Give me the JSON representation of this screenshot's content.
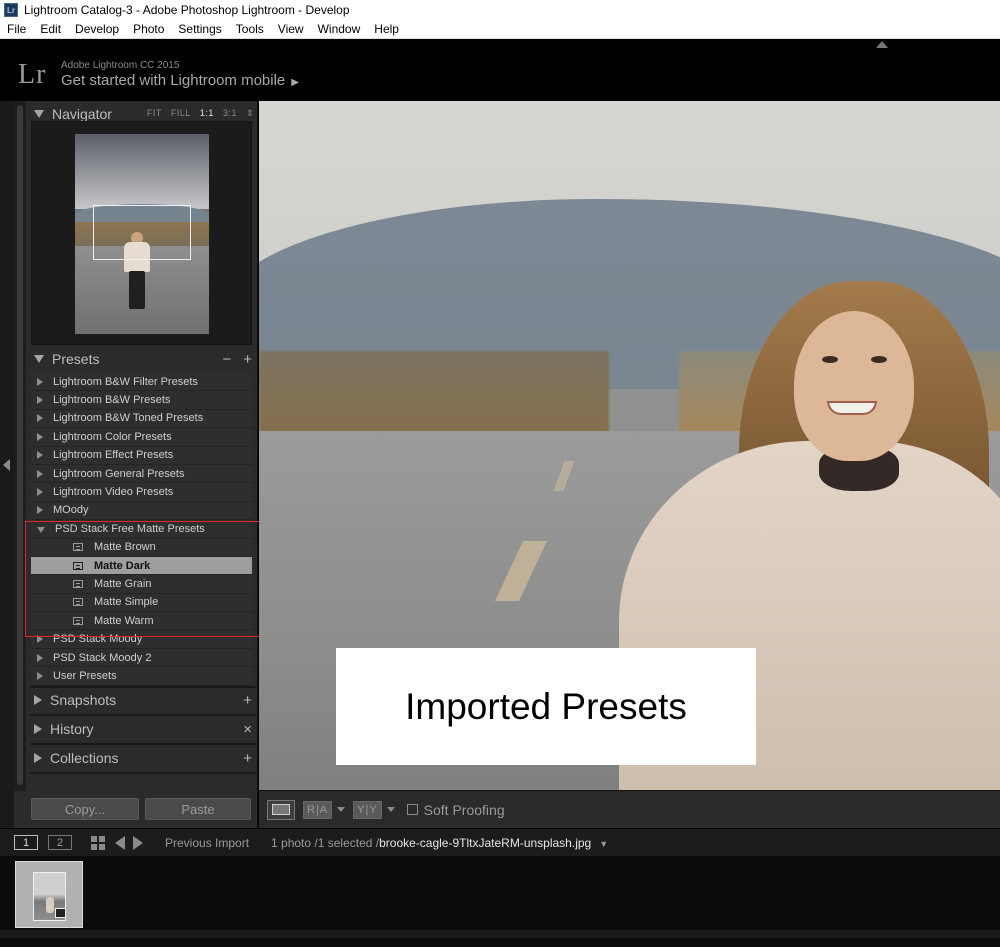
{
  "window": {
    "title": "Lightroom Catalog-3 - Adobe Photoshop Lightroom - Develop",
    "app_icon_text": "Lr"
  },
  "menu": [
    "File",
    "Edit",
    "Develop",
    "Photo",
    "Settings",
    "Tools",
    "View",
    "Window",
    "Help"
  ],
  "identity": {
    "logo": "Lr",
    "product": "Adobe Lightroom CC 2015",
    "mobile_prompt": "Get started with Lightroom mobile",
    "mobile_arrow": "▶"
  },
  "navigator": {
    "title": "Navigator",
    "zoom_options": [
      "FIT",
      "FILL",
      "1:1",
      "3:1"
    ],
    "active_zoom": "1:1"
  },
  "presets": {
    "title": "Presets",
    "minus": "−",
    "plus": "+",
    "folders": [
      {
        "label": "Lightroom B&W Filter Presets",
        "expanded": false
      },
      {
        "label": "Lightroom B&W Presets",
        "expanded": false
      },
      {
        "label": "Lightroom B&W Toned Presets",
        "expanded": false
      },
      {
        "label": "Lightroom Color Presets",
        "expanded": false
      },
      {
        "label": "Lightroom Effect Presets",
        "expanded": false
      },
      {
        "label": "Lightroom General Presets",
        "expanded": false
      },
      {
        "label": "Lightroom Video Presets",
        "expanded": false
      },
      {
        "label": "MOody",
        "expanded": false
      },
      {
        "label": "PSD Stack Free Matte Presets",
        "expanded": true
      }
    ],
    "children": [
      {
        "label": "Matte Brown",
        "selected": false
      },
      {
        "label": "Matte Dark",
        "selected": true
      },
      {
        "label": "Matte Grain",
        "selected": false
      },
      {
        "label": "Matte Simple",
        "selected": false
      },
      {
        "label": "Matte Warm",
        "selected": false
      }
    ],
    "after_folders": [
      {
        "label": "PSD Stack Moody",
        "expanded": false
      },
      {
        "label": "PSD Stack Moody 2",
        "expanded": false
      },
      {
        "label": "User Presets",
        "expanded": false
      }
    ],
    "highlight_color": "#e0262b"
  },
  "panels": {
    "snapshots": {
      "title": "Snapshots",
      "icon": "+"
    },
    "history": {
      "title": "History",
      "icon": "×"
    },
    "collections": {
      "title": "Collections",
      "icon": "+"
    }
  },
  "buttons": {
    "copy": "Copy...",
    "paste": "Paste"
  },
  "overlay": {
    "text": "Imported Presets"
  },
  "toolbar": {
    "before_after_1": "R|A",
    "before_after_2": "Y|Y",
    "soft_proofing": "Soft Proofing"
  },
  "filmstrip": {
    "screen1": "1",
    "screen2": "2",
    "source": "Previous Import",
    "count": "1 photo /1 selected /",
    "filename": "brooke-cagle-9TltxJateRM-unsplash.jpg"
  }
}
